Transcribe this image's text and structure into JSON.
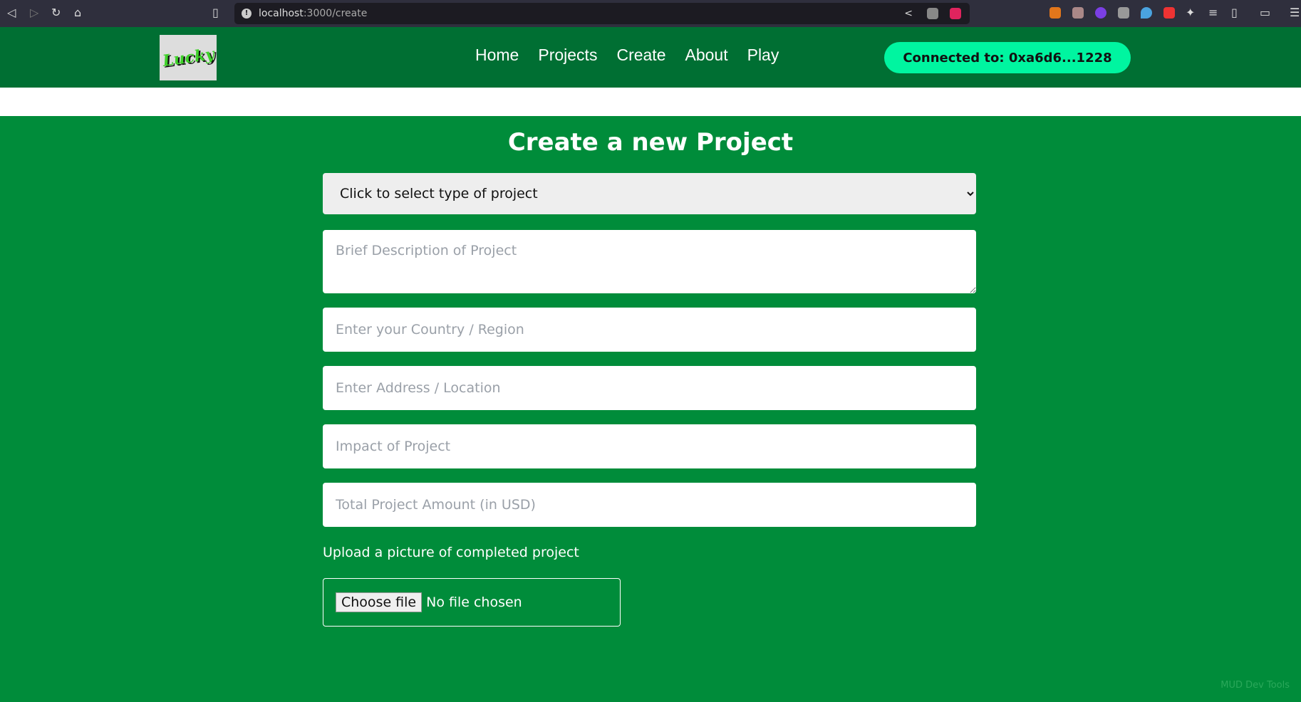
{
  "browser": {
    "url_host": "localhost",
    "url_path": ":3000/create"
  },
  "nav": {
    "logo_text": "Lucky",
    "links": [
      "Home",
      "Projects",
      "Create",
      "About",
      "Play"
    ],
    "connect_label": "Connected to: 0xa6d6...1228"
  },
  "colors": {
    "nav": "#006f33",
    "page": "#008c3a",
    "connect": "#00f5a0"
  },
  "form": {
    "title": "Create a new Project",
    "type_select": "Click to select type of project",
    "description_placeholder": "Brief Description of Project",
    "country_placeholder": "Enter your Country / Region",
    "address_placeholder": "Enter Address / Location",
    "impact_placeholder": "Impact of Project",
    "amount_placeholder": "Total Project Amount (in USD)",
    "upload_label": "Upload a picture of completed project",
    "choose_file": "Choose file",
    "no_file": "No file chosen"
  },
  "devtools": "MUD Dev Tools"
}
